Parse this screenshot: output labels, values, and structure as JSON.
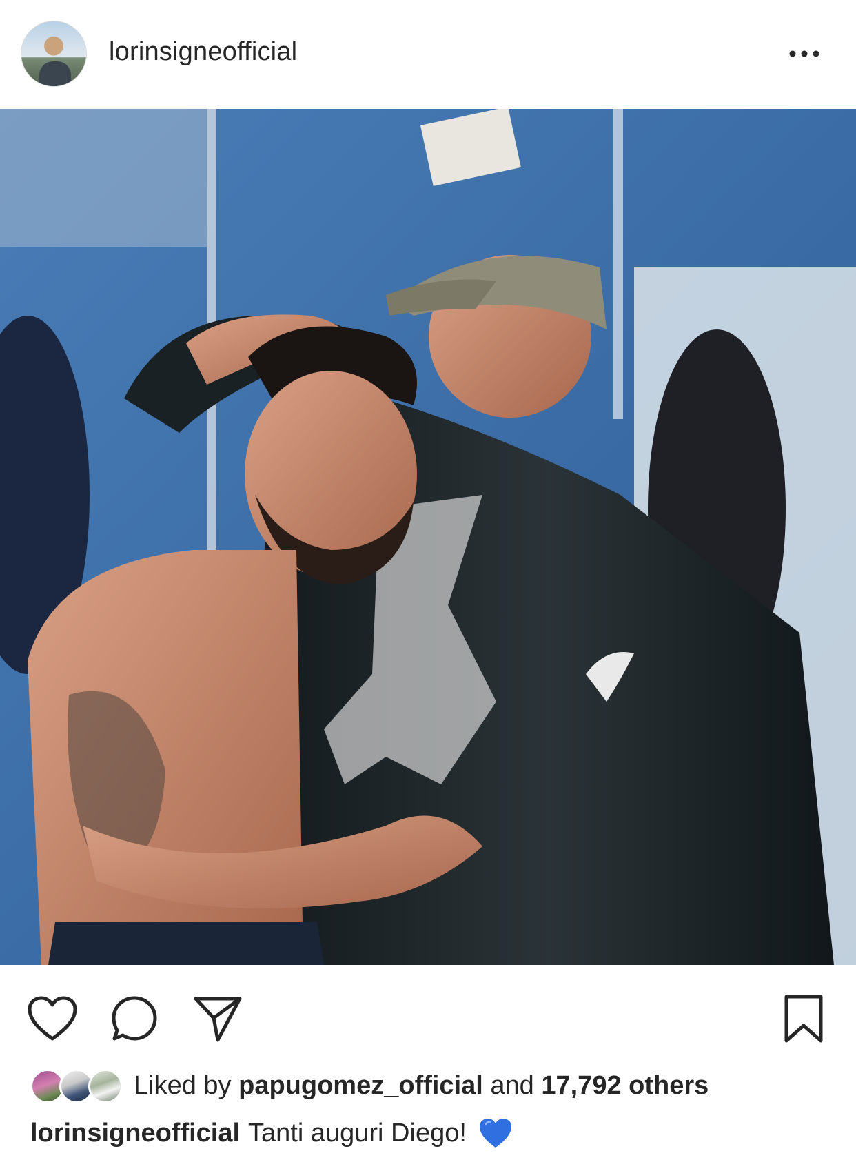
{
  "post": {
    "username": "lorinsigneofficial",
    "more_icon": "ellipsis-icon"
  },
  "photo": {
    "colors": {
      "wall": "#3a6ea9",
      "skin": "#c98a6a",
      "jacket": "#1b2226",
      "cap": "#8f8c79"
    }
  },
  "actions": {
    "like_icon": "heart-outline-icon",
    "comment_icon": "comment-bubble-icon",
    "share_icon": "paper-plane-icon",
    "save_icon": "bookmark-icon"
  },
  "likes": {
    "prefix": "Liked by",
    "user": "papugomez_official",
    "middle": "and",
    "others": "17,792 others"
  },
  "caption": {
    "username": "lorinsigneofficial",
    "text": "Tanti auguri Diego!",
    "emoji": "blue-heart-icon",
    "emoji_color": "#2f6fe0"
  }
}
